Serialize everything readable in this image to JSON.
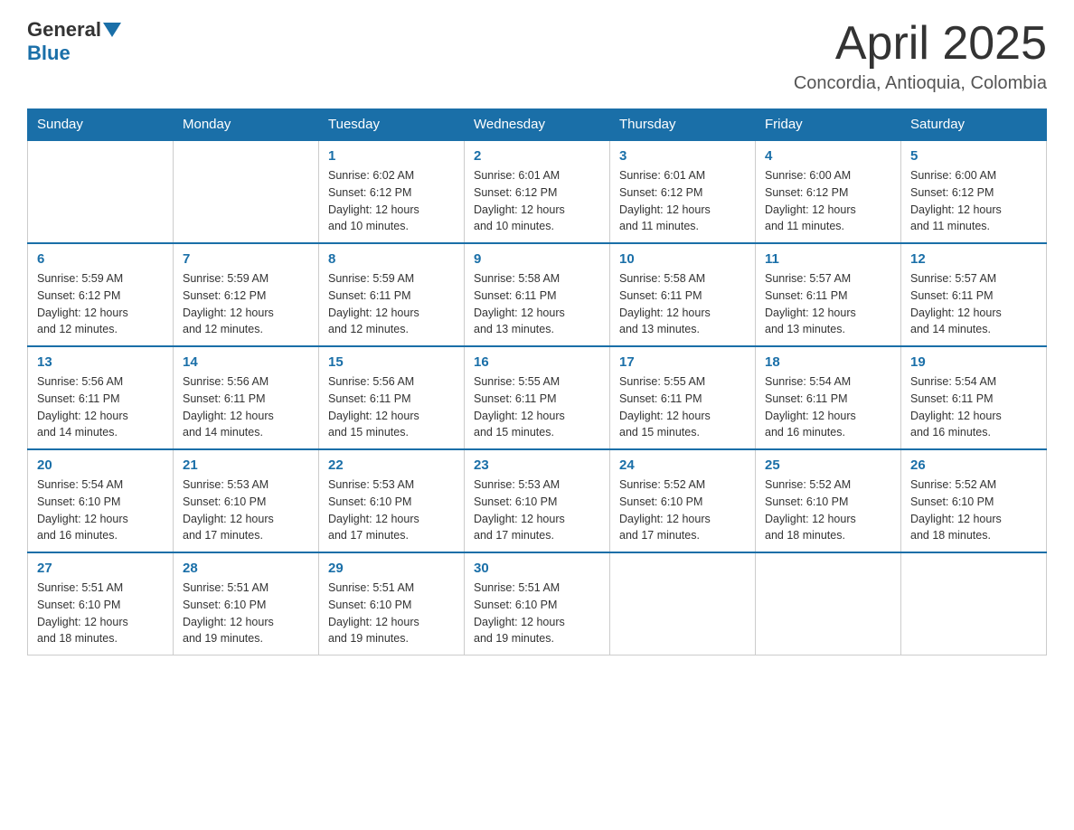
{
  "header": {
    "logo_general": "General",
    "logo_blue": "Blue",
    "month_title": "April 2025",
    "subtitle": "Concordia, Antioquia, Colombia"
  },
  "weekdays": [
    "Sunday",
    "Monday",
    "Tuesday",
    "Wednesday",
    "Thursday",
    "Friday",
    "Saturday"
  ],
  "weeks": [
    [
      {
        "day": "",
        "info": ""
      },
      {
        "day": "",
        "info": ""
      },
      {
        "day": "1",
        "info": "Sunrise: 6:02 AM\nSunset: 6:12 PM\nDaylight: 12 hours\nand 10 minutes."
      },
      {
        "day": "2",
        "info": "Sunrise: 6:01 AM\nSunset: 6:12 PM\nDaylight: 12 hours\nand 10 minutes."
      },
      {
        "day": "3",
        "info": "Sunrise: 6:01 AM\nSunset: 6:12 PM\nDaylight: 12 hours\nand 11 minutes."
      },
      {
        "day": "4",
        "info": "Sunrise: 6:00 AM\nSunset: 6:12 PM\nDaylight: 12 hours\nand 11 minutes."
      },
      {
        "day": "5",
        "info": "Sunrise: 6:00 AM\nSunset: 6:12 PM\nDaylight: 12 hours\nand 11 minutes."
      }
    ],
    [
      {
        "day": "6",
        "info": "Sunrise: 5:59 AM\nSunset: 6:12 PM\nDaylight: 12 hours\nand 12 minutes."
      },
      {
        "day": "7",
        "info": "Sunrise: 5:59 AM\nSunset: 6:12 PM\nDaylight: 12 hours\nand 12 minutes."
      },
      {
        "day": "8",
        "info": "Sunrise: 5:59 AM\nSunset: 6:11 PM\nDaylight: 12 hours\nand 12 minutes."
      },
      {
        "day": "9",
        "info": "Sunrise: 5:58 AM\nSunset: 6:11 PM\nDaylight: 12 hours\nand 13 minutes."
      },
      {
        "day": "10",
        "info": "Sunrise: 5:58 AM\nSunset: 6:11 PM\nDaylight: 12 hours\nand 13 minutes."
      },
      {
        "day": "11",
        "info": "Sunrise: 5:57 AM\nSunset: 6:11 PM\nDaylight: 12 hours\nand 13 minutes."
      },
      {
        "day": "12",
        "info": "Sunrise: 5:57 AM\nSunset: 6:11 PM\nDaylight: 12 hours\nand 14 minutes."
      }
    ],
    [
      {
        "day": "13",
        "info": "Sunrise: 5:56 AM\nSunset: 6:11 PM\nDaylight: 12 hours\nand 14 minutes."
      },
      {
        "day": "14",
        "info": "Sunrise: 5:56 AM\nSunset: 6:11 PM\nDaylight: 12 hours\nand 14 minutes."
      },
      {
        "day": "15",
        "info": "Sunrise: 5:56 AM\nSunset: 6:11 PM\nDaylight: 12 hours\nand 15 minutes."
      },
      {
        "day": "16",
        "info": "Sunrise: 5:55 AM\nSunset: 6:11 PM\nDaylight: 12 hours\nand 15 minutes."
      },
      {
        "day": "17",
        "info": "Sunrise: 5:55 AM\nSunset: 6:11 PM\nDaylight: 12 hours\nand 15 minutes."
      },
      {
        "day": "18",
        "info": "Sunrise: 5:54 AM\nSunset: 6:11 PM\nDaylight: 12 hours\nand 16 minutes."
      },
      {
        "day": "19",
        "info": "Sunrise: 5:54 AM\nSunset: 6:11 PM\nDaylight: 12 hours\nand 16 minutes."
      }
    ],
    [
      {
        "day": "20",
        "info": "Sunrise: 5:54 AM\nSunset: 6:10 PM\nDaylight: 12 hours\nand 16 minutes."
      },
      {
        "day": "21",
        "info": "Sunrise: 5:53 AM\nSunset: 6:10 PM\nDaylight: 12 hours\nand 17 minutes."
      },
      {
        "day": "22",
        "info": "Sunrise: 5:53 AM\nSunset: 6:10 PM\nDaylight: 12 hours\nand 17 minutes."
      },
      {
        "day": "23",
        "info": "Sunrise: 5:53 AM\nSunset: 6:10 PM\nDaylight: 12 hours\nand 17 minutes."
      },
      {
        "day": "24",
        "info": "Sunrise: 5:52 AM\nSunset: 6:10 PM\nDaylight: 12 hours\nand 17 minutes."
      },
      {
        "day": "25",
        "info": "Sunrise: 5:52 AM\nSunset: 6:10 PM\nDaylight: 12 hours\nand 18 minutes."
      },
      {
        "day": "26",
        "info": "Sunrise: 5:52 AM\nSunset: 6:10 PM\nDaylight: 12 hours\nand 18 minutes."
      }
    ],
    [
      {
        "day": "27",
        "info": "Sunrise: 5:51 AM\nSunset: 6:10 PM\nDaylight: 12 hours\nand 18 minutes."
      },
      {
        "day": "28",
        "info": "Sunrise: 5:51 AM\nSunset: 6:10 PM\nDaylight: 12 hours\nand 19 minutes."
      },
      {
        "day": "29",
        "info": "Sunrise: 5:51 AM\nSunset: 6:10 PM\nDaylight: 12 hours\nand 19 minutes."
      },
      {
        "day": "30",
        "info": "Sunrise: 5:51 AM\nSunset: 6:10 PM\nDaylight: 12 hours\nand 19 minutes."
      },
      {
        "day": "",
        "info": ""
      },
      {
        "day": "",
        "info": ""
      },
      {
        "day": "",
        "info": ""
      }
    ]
  ]
}
